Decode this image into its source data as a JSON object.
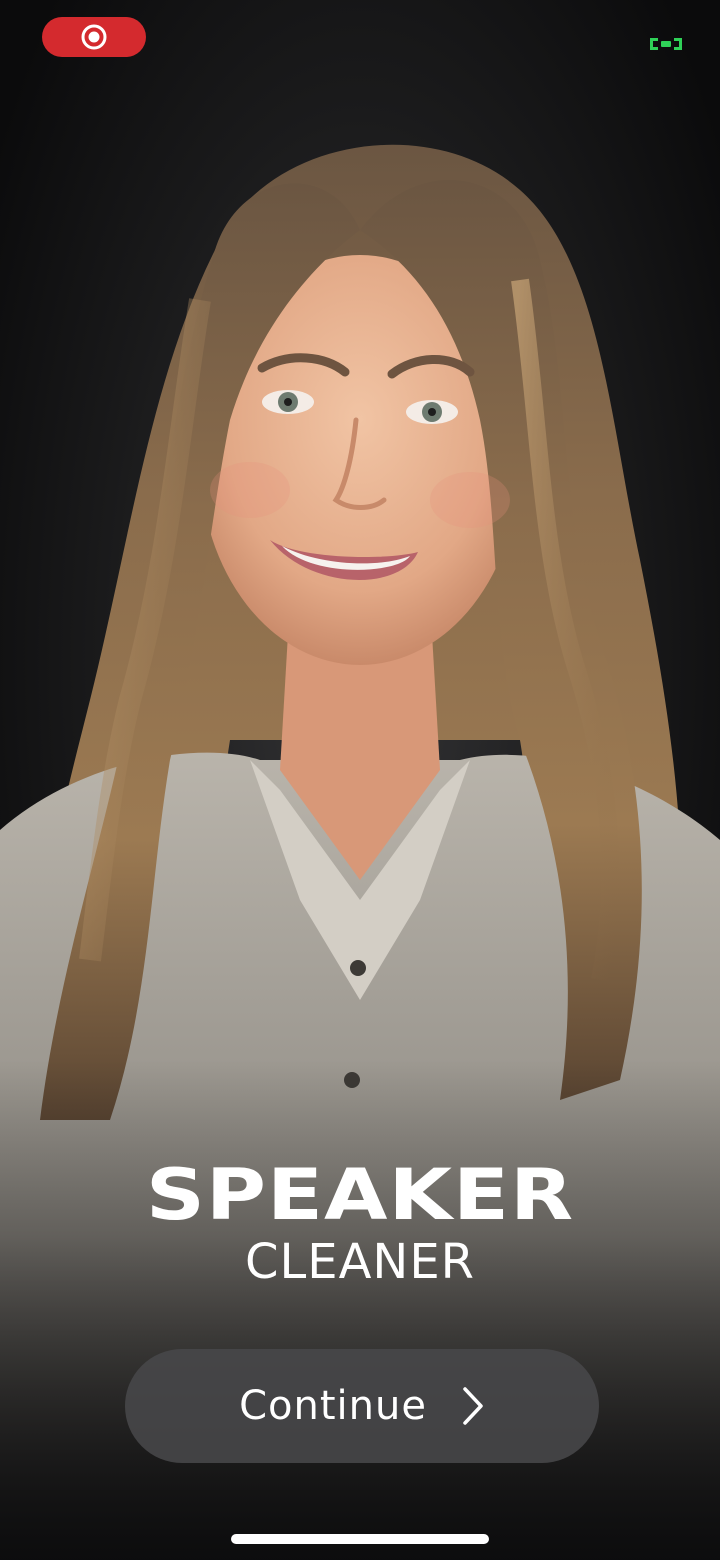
{
  "app": {
    "title_main": "SPEAKER",
    "title_sub": "CLEANER"
  },
  "actions": {
    "continue_label": "Continue"
  },
  "icons": {
    "record": "screen-record-icon",
    "status": "status-indicator-icon",
    "continue": "chevron-right-icon"
  },
  "colors": {
    "record_pill": "#d42a2e",
    "status_indicator": "#2fd158",
    "button_bg": "#48484a",
    "text": "#ffffff",
    "background": "#0b0b0c"
  }
}
